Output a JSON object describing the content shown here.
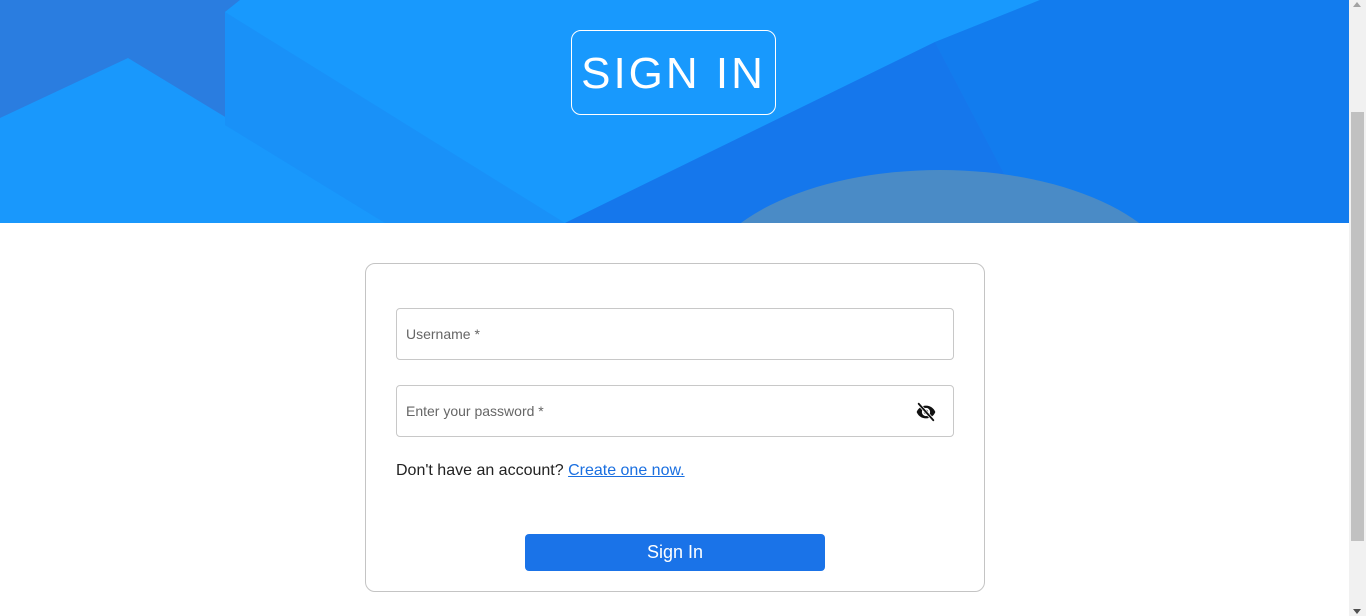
{
  "hero": {
    "title": "SIGN IN"
  },
  "form": {
    "username": {
      "placeholder": "Username *",
      "value": ""
    },
    "password": {
      "placeholder": "Enter your password *",
      "value": "",
      "toggle_icon": "eye-slash-icon"
    },
    "signup": {
      "prompt": "Don't have an account? ",
      "link_text": "Create one now."
    },
    "submit_label": "Sign In"
  },
  "colors": {
    "hero_background": "#1a8cf2",
    "primary_button": "#1a73e8",
    "link": "#1a6fe0"
  }
}
